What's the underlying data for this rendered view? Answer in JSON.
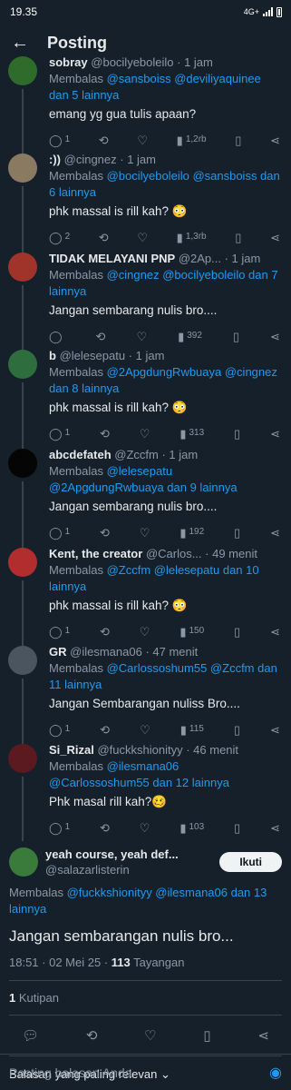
{
  "status": {
    "time": "19.35",
    "network": "4G+"
  },
  "header": {
    "back_icon": "←",
    "title": "Posting"
  },
  "replies": [
    {
      "name": "sobray",
      "handle": "@bocilyeboleilo",
      "time": "· 1 jam",
      "replying_prefix": "Membalas ",
      "replying_to": "@sansboiss @deviliyaquinee dan 5 lainnya",
      "text": "emang yg gua tulis apaan?",
      "replies_count": "1",
      "likes": "",
      "views": "1,2rb",
      "avatar_color": "#2f6b2a"
    },
    {
      "name": ":))",
      "handle": "@cingnez",
      "time": "· 1 jam",
      "replying_prefix": "Membalas ",
      "replying_to": "@bocilyeboleilo @sansboiss dan 6 lainnya",
      "text": "phk massal is rill kah? 😳",
      "replies_count": "2",
      "likes": "",
      "views": "1,3rb",
      "avatar_color": "#8a7a62"
    },
    {
      "name": "TIDAK MELAYANI PNP",
      "handle": "@2Ap...",
      "time": "· 1 jam",
      "replying_prefix": "Membalas ",
      "replying_to": "@cingnez @bocilyeboleilo dan 7 lainnya",
      "text": "Jangan sembarang nulis bro....",
      "replies_count": "",
      "likes": "",
      "views": "392",
      "avatar_color": "#a0332a"
    },
    {
      "name": "b",
      "handle": "@lelesepatu",
      "time": "· 1 jam",
      "replying_prefix": "Membalas ",
      "replying_to": "@2ApgdungRwbuaya @cingnez dan 8 lainnya",
      "text": "phk massal is rill kah? 😳",
      "replies_count": "1",
      "likes": "",
      "views": "313",
      "avatar_color": "#2e6e3e"
    },
    {
      "name": "abcdefateh",
      "handle": "@Zccfm",
      "time": "· 1 jam",
      "replying_prefix": "Membalas ",
      "replying_to": "@lelesepatu @2ApgdungRwbuaya dan 9 lainnya",
      "text": "Jangan sembarang nulis bro....",
      "replies_count": "1",
      "likes": "",
      "views": "192",
      "avatar_color": "#050505"
    },
    {
      "name": "Kent, the creator",
      "handle": "@Carlos...",
      "time": "· 49 menit",
      "replying_prefix": "Membalas ",
      "replying_to": "@Zccfm @lelesepatu dan 10 lainnya",
      "text": "phk massal is rill kah? 😳",
      "replies_count": "1",
      "likes": "",
      "views": "150",
      "avatar_color": "#b22d2d"
    },
    {
      "name": "GR",
      "handle": "@ilesmana06",
      "time": "· 47 menit",
      "replying_prefix": "Membalas ",
      "replying_to": "@Carlossoshum55 @Zccfm dan 11 lainnya",
      "text": "Jangan Sembarangan nuliss Bro....",
      "replies_count": "1",
      "likes": "",
      "views": "115",
      "avatar_color": "#4a5560"
    },
    {
      "name": "Si_Rizal",
      "handle": "@fuckkshionityy",
      "time": "· 46 menit",
      "replying_prefix": "Membalas ",
      "replying_to": "@ilesmana06 @Carlossoshum55 dan 12 lainnya",
      "text": "Phk masal rill kah?🥴",
      "replies_count": "1",
      "likes": "",
      "views": "103",
      "avatar_color": "#5a1a1f"
    }
  ],
  "main_post": {
    "name": "yeah course, yeah def...",
    "handle": "@salazarlisterin",
    "follow_label": "Ikuti",
    "replying_prefix": "Membalas ",
    "replying_to": "@fuckkshionityy @ilesmana06 dan 13 lainnya",
    "text": "Jangan sembarangan nulis bro...",
    "timestamp": "18:51 · 02 Mei 25 · ",
    "views_count": "113",
    "views_label": " Tayangan",
    "avatar_color": "#3a7a3a"
  },
  "quotes": {
    "count": "1",
    "label": " Kutipan"
  },
  "sort_label": "Balasan yang paling relevan",
  "compose": {
    "placeholder": "Posting balasan Anda"
  }
}
